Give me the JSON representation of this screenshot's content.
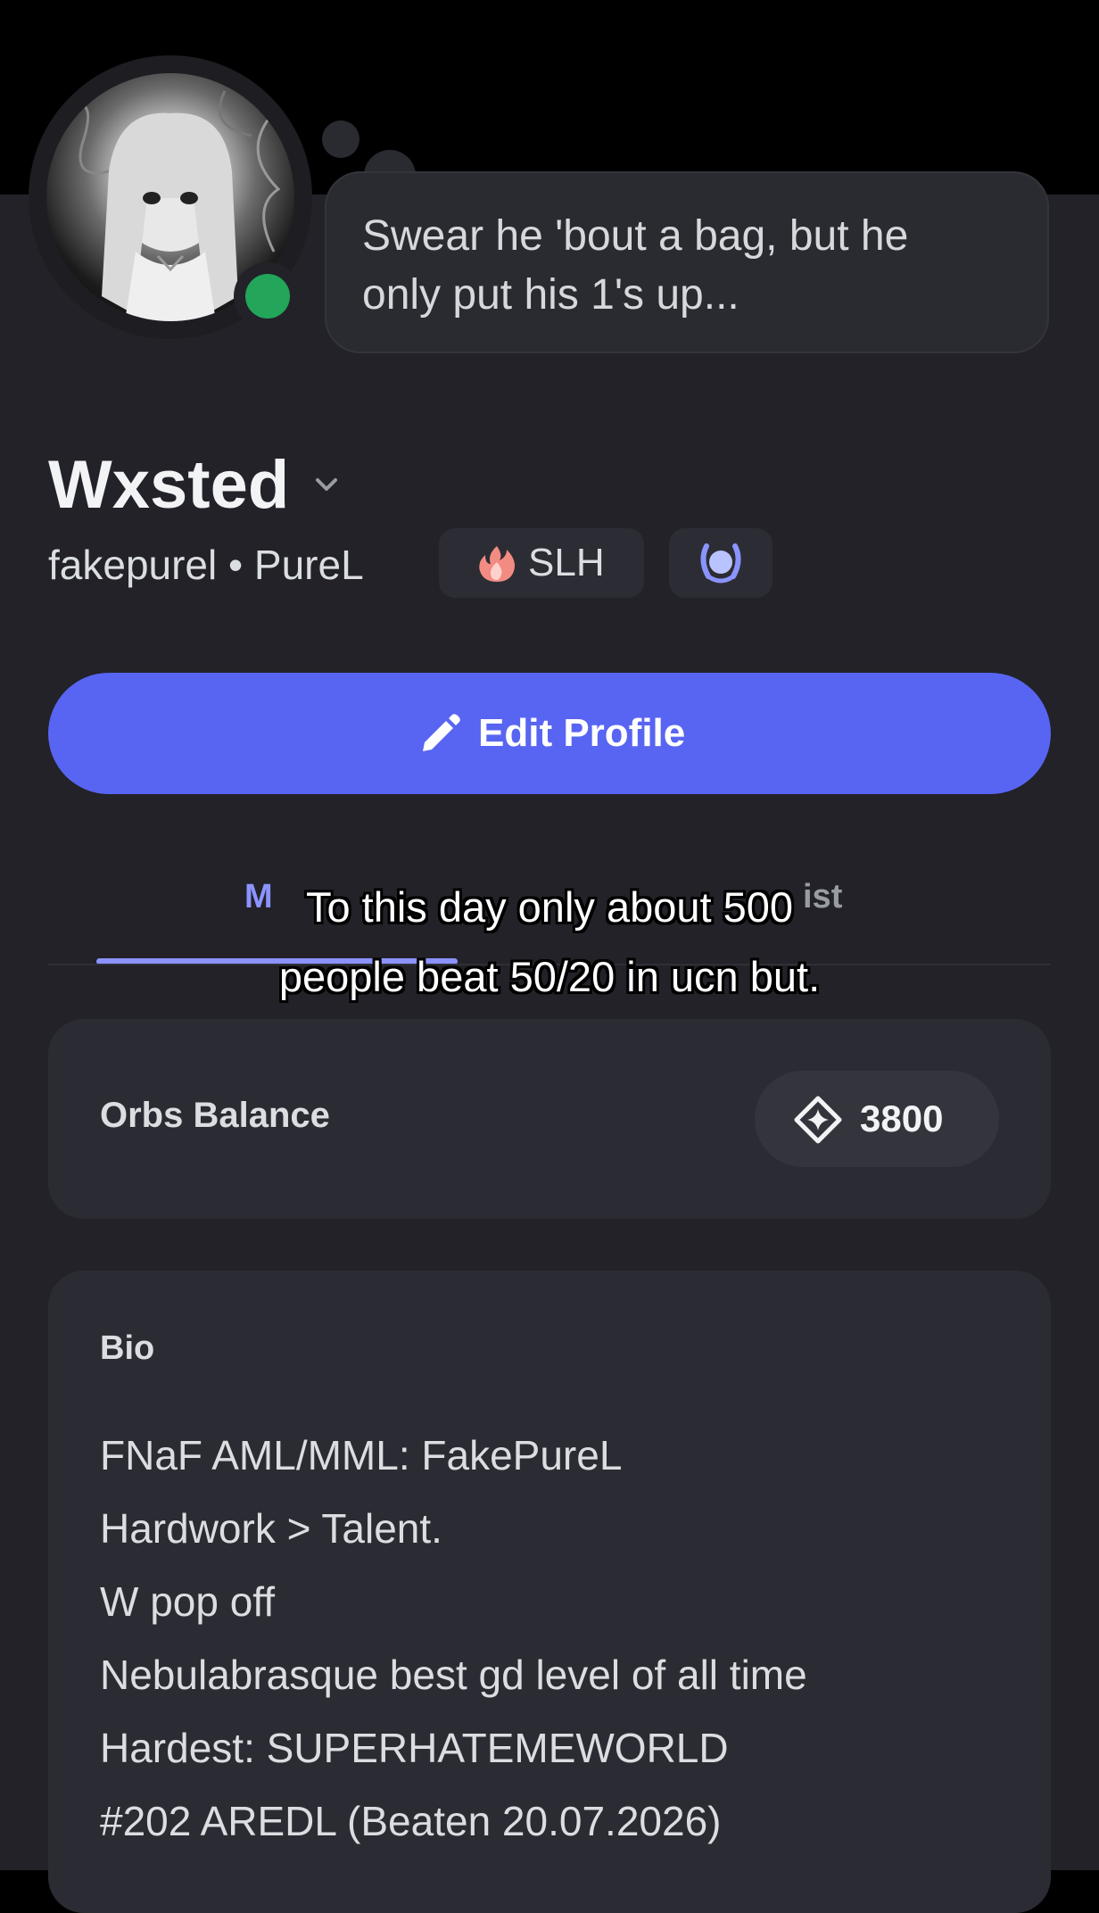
{
  "status_bubble": {
    "text": "Swear he 'bout a bag, but he only put his 1's up..."
  },
  "profile": {
    "display_name": "Wxsted",
    "username": "fakepurel",
    "separator": "•",
    "pronouns": "PureL",
    "guild_tag": "SLH",
    "status": "online"
  },
  "actions": {
    "edit_profile": "Edit Profile"
  },
  "tabs": [
    {
      "label": "M",
      "active": true
    },
    {
      "label": "ist",
      "active": false
    }
  ],
  "caption": {
    "line1": "To this day only about 500",
    "line2": "people beat 50/20 in ucn but."
  },
  "orbs": {
    "label": "Orbs Balance",
    "value": "3800"
  },
  "bio": {
    "title": "Bio",
    "lines": [
      "FNaF AML/MML: FakePureL",
      "Hardwork > Talent.",
      "W pop off",
      "Nebulabrasque best gd level of all time",
      "Hardest: SUPERHATEMEWORLD",
      "#202 AREDL (Beaten 20.07.2026)"
    ]
  },
  "colors": {
    "accent": "#5865f2",
    "tab_active": "#8b93ff",
    "online": "#23a55a",
    "panel": "#222228",
    "card": "#2b2c33"
  },
  "icons": [
    "chevron-down-icon",
    "flame-icon",
    "laurel-badge-icon",
    "pencil-icon",
    "orb-icon"
  ]
}
